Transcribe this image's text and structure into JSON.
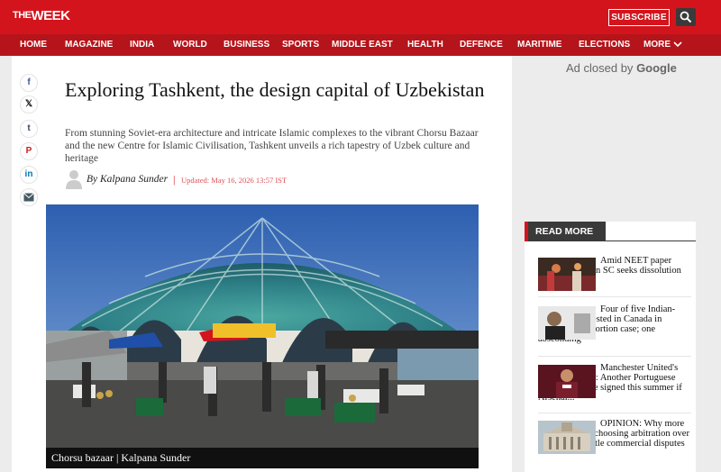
{
  "brand": {
    "logo_the": "THE",
    "logo_week": "WEEK"
  },
  "header": {
    "subscribe_label": "SUBSCRIBE",
    "search_icon": "search-icon"
  },
  "nav": {
    "items": [
      "HOME",
      "MAGAZINE",
      "INDIA",
      "WORLD",
      "BUSINESS",
      "SPORTS",
      "MIDDLE EAST",
      "HEALTH",
      "DEFENCE",
      "MARITIME",
      "ELECTIONS"
    ],
    "more_label": "MORE"
  },
  "share": {
    "facebook": "f",
    "x": "𝕏",
    "tumblr": "t",
    "pinterest": "P",
    "linkedin": "in",
    "email": "email-icon"
  },
  "article": {
    "title": "Exploring Tashkent, the design capital of Uzbekistan",
    "dek": "From stunning Soviet-era architecture and intricate Islamic complexes to the vibrant Chorsu Bazaar and the new Centre for Islamic Civilisation, Tashkent unveils a rich tapestry of Uzbek culture and heritage",
    "byline": "By Kalpana Sunder",
    "separator": "|",
    "updated": "Updated: May 16, 2026 13:57 IST",
    "image_caption": "Chorsu bazaar | Kalpana Sunder"
  },
  "ad": {
    "closed_prefix": "Ad closed by",
    "closed_brand": "Google"
  },
  "read_more": {
    "heading": "READ MORE",
    "items": [
      "Amid NEET paper leak row, plea in SC seeks dissolution of NTA",
      "Four of five Indian-origin men arrested in Canada in kidnapping-extortion case; one absconding",
      "Manchester United's new midfielder: Another Portuguese Fernandes to be signed this summer if Arsenal...",
      "OPINION: Why more businesses are choosing arbitration over litigation to settle commercial disputes"
    ]
  },
  "colors": {
    "brand_red": "#d4141c",
    "nav_red": "#b5141b",
    "dark": "#3a3a3a"
  }
}
